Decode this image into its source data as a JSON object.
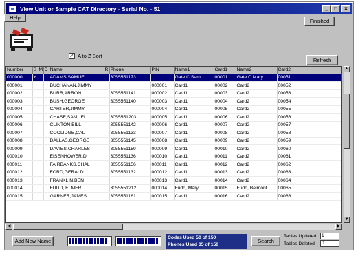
{
  "window": {
    "title": "View Unit or Sample CAT Directory - Serial No. - 51",
    "minimize": "_",
    "maximize": "□",
    "close": "×"
  },
  "toolbar": {
    "help_label": "Help",
    "finished_label": "Finished",
    "refresh_label": "Refresh",
    "sort_label": "A to Z Sort",
    "sort_checked": "✓"
  },
  "logo": {
    "icon": "cat-directory-logo",
    "colors": {
      "red": "#c4281c",
      "black": "#1a1a1a"
    }
  },
  "table": {
    "columns": [
      "Number",
      "S",
      "M",
      "D",
      "Name",
      "R",
      "Phone",
      "PIN",
      "Name1",
      "Card1",
      "Name2",
      "Card2"
    ],
    "rows": [
      [
        "000000",
        "Y",
        "",
        "",
        "ADAMS,SAMUEL",
        "",
        "3055551173",
        "",
        "Gate C Sam",
        "00001",
        "Gate C Mary",
        "00051"
      ],
      [
        "000001",
        "",
        "",
        "",
        "BUCHANAN,JIMMY",
        "",
        "",
        "000001",
        "Card1",
        "00002",
        "Card2",
        "00052"
      ],
      [
        "000002",
        "",
        "",
        "",
        "BURR,ARRON",
        "",
        "3055551141",
        "000002",
        "Card1",
        "00003",
        "Card2",
        "00053"
      ],
      [
        "000003",
        "",
        "",
        "",
        "BUSH,GEORGE",
        "",
        "3055551140",
        "000003",
        "Card1",
        "00004",
        "Card2",
        "00054"
      ],
      [
        "000004",
        "",
        "",
        "",
        "CARTER,JIMMY",
        "",
        "",
        "000004",
        "Card1",
        "00005",
        "Card2",
        "00055"
      ],
      [
        "000005",
        "",
        "",
        "",
        "CHASE,SAMUEL",
        "",
        "3055551203",
        "000005",
        "Card1",
        "00006",
        "Card2",
        "00056"
      ],
      [
        "000006",
        "",
        "",
        "",
        "CLINTON,BILL",
        "",
        "3055551142",
        "000006",
        "Card1",
        "00007",
        "Card2",
        "00057"
      ],
      [
        "000007",
        "",
        "",
        "",
        "COOLIDGE,CAL",
        "",
        "3055551133",
        "000007",
        "Card1",
        "00008",
        "Card2",
        "00058"
      ],
      [
        "000008",
        "",
        "",
        "",
        "DALLAS,GEORGE",
        "",
        "3055551145",
        "000008",
        "Card1",
        "00009",
        "Card2",
        "00059"
      ],
      [
        "000009",
        "",
        "",
        "",
        "DAVIES,CHARLES",
        "",
        "3055551159",
        "000009",
        "Card1",
        "00010",
        "Card2",
        "00060"
      ],
      [
        "000010",
        "",
        "",
        "",
        "EISENHOWER,D",
        "",
        "3055551136",
        "000010",
        "Card1",
        "00011",
        "Card2",
        "00061"
      ],
      [
        "000011",
        "",
        "",
        "",
        "FAIRBANKS,CHAL",
        "",
        "3055551156",
        "000011",
        "Card1",
        "00012",
        "Card2",
        "00062"
      ],
      [
        "000012",
        "",
        "",
        "",
        "FORD,GERALD",
        "",
        "3055551132",
        "000012",
        "Card1",
        "00013",
        "Card2",
        "00063"
      ],
      [
        "000013",
        "",
        "",
        "",
        "FRANKLIN,BEN",
        "",
        "",
        "000013",
        "Card1",
        "00014",
        "Card2",
        "00064"
      ],
      [
        "000014",
        "",
        "",
        "",
        "FUDD, ELMER",
        "",
        "3055551212",
        "000014",
        "Fudd, Mary",
        "00015",
        "Fudd, Belmont",
        "00065"
      ],
      [
        "000015",
        "",
        "",
        "",
        "GARNER,JAMES",
        "",
        "3055551161",
        "000015",
        "Card1",
        "00016",
        "Card2",
        "00066"
      ]
    ]
  },
  "footer": {
    "add_new_label": "Add New Name",
    "codes_text": "Codes Used 50 of 150",
    "phones_text": "Phones Used 35 of 150",
    "search_label": "Search",
    "tables_updated_label": "Tables Updated",
    "tables_deleted_label": "Tables Deleted",
    "tables_updated_value": "1",
    "tables_deleted_value": "0"
  }
}
